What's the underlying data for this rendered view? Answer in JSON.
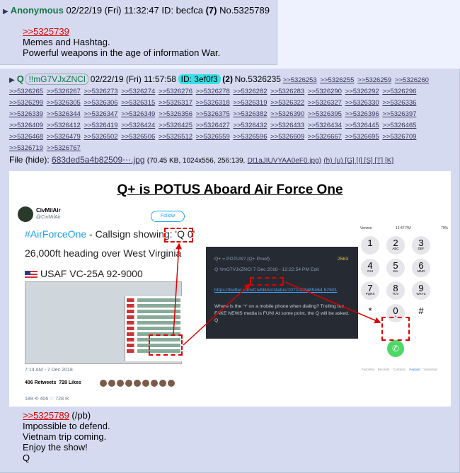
{
  "post1": {
    "name": "Anonymous",
    "datetime": "02/22/19 (Fri) 11:32:47",
    "id_label": "ID:",
    "id": "becfca",
    "id_count": "(7)",
    "number": "No.5325789",
    "quote": ">>5325739",
    "lines": [
      "Memes and Hashtag.",
      "Powerful weapons in the age of information War."
    ]
  },
  "post2": {
    "name": "Q",
    "tripcode": "!!mG7VJxZNCI",
    "datetime": "02/22/19 (Fri) 11:57:58",
    "id_pill": "ID: 3ef0f3",
    "id_count": "(2)",
    "number": "No.5326235",
    "replies": [
      ">>5326253",
      ">>5326255",
      ">>5326259",
      ">>5326260",
      ">>5326265",
      ">>5326267",
      ">>5326273",
      ">>5326274",
      ">>5326276",
      ">>5326278",
      ">>5326282",
      ">>5326283",
      ">>5326290",
      ">>5326292",
      ">>5326296",
      ">>5326299",
      ">>5326305",
      ">>5326306",
      ">>5326315",
      ">>5326317",
      ">>5326318",
      ">>5326319",
      ">>5326322",
      ">>5326327",
      ">>5326330",
      ">>5326336",
      ">>5326339",
      ">>5326344",
      ">>5326347",
      ">>5326349",
      ">>5326356",
      ">>5326375",
      ">>5326382",
      ">>5326390",
      ">>5326395",
      ">>5326396",
      ">>5326397",
      ">>5326409",
      ">>5326412",
      ">>5326419",
      ">>5326424",
      ">>5326425",
      ">>5326427",
      ">>5326432",
      ">>5326433",
      ">>5326434",
      ">>5326445",
      ">>5326465",
      ">>5326468",
      ">>5326479",
      ">>5326502",
      ">>5326506",
      ">>5326512",
      ">>5326559",
      ">>5326596",
      ">>5326609",
      ">>5326667",
      ">>5326695",
      ">>5326709",
      ">>5326719",
      ">>5326767"
    ],
    "file": {
      "label": "File",
      "hide": "(hide):",
      "filename": "683ded5a4b82509⋯.jpg",
      "meta": "(70.45 KB, 1024x556, 256:139,",
      "orig": "Dt1aJIUVYAA0eF0.jpg)",
      "tools": "(h) (u) [G] [I] [S] [T] [K]"
    },
    "image": {
      "title": "Q+ is POTUS Aboard Air Force One",
      "tweet": {
        "account": "CivMilAir",
        "handle": "@CivMilAir",
        "follow": "Follow",
        "hashtag": "#AirForceOne",
        "line1_rest": " - Callsign showing: 'Q 0'",
        "line2": "26,000ft heading over West Virginia",
        "line3": "USAF VC-25A 92-9000",
        "date": "7:14 AM - 7 Dec 2018",
        "retweets": "406 Retweets",
        "likes": "728 Likes",
        "actions": "189   ⟲ 406   ♡ 728   ✉"
      },
      "q_card": {
        "title": "Q+ = POTUS? (Q+ Proof)",
        "count": "2563",
        "byline": "Q !!mG7VJxZNCI  7 Dec 2018 - 12:22:54 PM  Edit",
        "link": "https://twitter.com/CivMilAir/status/1071063485464 57601",
        "text": "Where is the '+' on a mobile phone when dialing? Trolling the FAKE NEWS media is FUN! At some point, the Q will be asked. Q"
      },
      "phone": {
        "carrier": "Verizon",
        "time": "12:47 PM",
        "battery": "79%",
        "keys": [
          {
            "d": "1",
            "s": ""
          },
          {
            "d": "2",
            "s": "ABC"
          },
          {
            "d": "3",
            "s": "DEF"
          },
          {
            "d": "4",
            "s": "GHI"
          },
          {
            "d": "5",
            "s": "JKL"
          },
          {
            "d": "6",
            "s": "MNO"
          },
          {
            "d": "7",
            "s": "PQRS"
          },
          {
            "d": "8",
            "s": "TUV"
          },
          {
            "d": "9",
            "s": "WXYZ"
          },
          {
            "d": "*",
            "s": ""
          },
          {
            "d": "0",
            "s": "+"
          },
          {
            "d": "#",
            "s": ""
          }
        ],
        "tabs": [
          "Favorites",
          "Recents",
          "Contacts",
          "Keypad",
          "Voicemail"
        ]
      }
    },
    "quote": ">>5325789",
    "quote_suffix": " (/pb)",
    "lines": [
      "Impossible to defend.",
      "Vietnam trip coming.",
      "Enjoy the show!",
      "Q"
    ]
  }
}
